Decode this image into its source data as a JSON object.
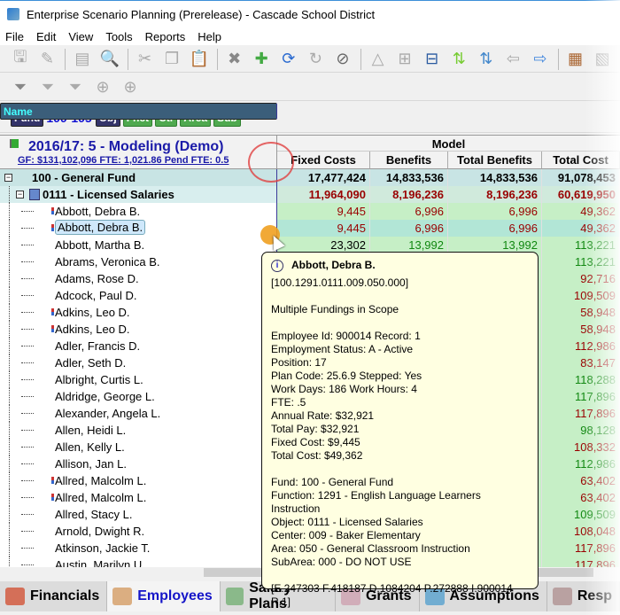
{
  "window": {
    "title": "Enterprise Scenario Planning (Prerelease) - Cascade School District"
  },
  "menu": [
    "File",
    "Edit",
    "View",
    "Tools",
    "Reports",
    "Help"
  ],
  "toolbar1": [
    "save-icon",
    "edit-icon",
    "print-preview-icon",
    "search-report-icon",
    "cut-icon",
    "copy-icon",
    "paste-icon",
    "delete-icon",
    "add-icon",
    "refresh-icon",
    "reload-icon",
    "cancel-icon",
    "budget-icon",
    "expand-icon",
    "collapse-icon",
    "sort-up-icon",
    "sort-down-icon",
    "back-icon",
    "forward-icon",
    "calculator-icon",
    "excel-icon"
  ],
  "toolbar2": [
    "new-filter-icon",
    "edit-filter-icon",
    "remove-filter-icon",
    "target-icon",
    "target-clear-icon"
  ],
  "filters": {
    "chips": [
      {
        "label": "Fund",
        "style": "navy"
      },
      {
        "label": "100-105",
        "style": "range"
      },
      {
        "label": "Obj",
        "style": "navy"
      },
      {
        "label": "Fnct",
        "style": "grn"
      },
      {
        "label": "Ctr",
        "style": "grn"
      },
      {
        "label": "Area",
        "style": "grn"
      },
      {
        "label": "Sub",
        "style": "grn"
      },
      {
        "label": "Name",
        "style": "nm"
      }
    ]
  },
  "grid": {
    "scenario_title": "2016/17: 5 - Modeling  (Demo)",
    "scenario_summary": "GF: $131,102,096  FTE: 1,021.86  Pend FTE: 0.5",
    "group_header": "Model",
    "columns": [
      "Fixed Costs",
      "Benefits",
      "Total Benefits",
      "Total Cost"
    ],
    "colors": {
      "red": "#990000",
      "green": "#118811",
      "black": "#000000"
    },
    "rows": [
      {
        "level": 0,
        "name": "100 - General Fund",
        "values": [
          "17,477,424",
          "14,833,536",
          "14,833,536",
          "91,078,453"
        ],
        "color": "black"
      },
      {
        "level": 1,
        "name": "0111 - Licensed Salaries",
        "values": [
          "11,964,090",
          "8,196,236",
          "8,196,236",
          "60,619,950"
        ],
        "color": "red"
      },
      {
        "level": 2,
        "name": "Abbott, Debra B.",
        "multi": true,
        "values": [
          "9,445",
          "6,996",
          "6,996",
          "49,362"
        ],
        "color": "red"
      },
      {
        "level": 2,
        "name": "Abbott, Debra B.",
        "multi": true,
        "selected": true,
        "values": [
          "9,445",
          "6,996",
          "6,996",
          "49,362"
        ],
        "color": "red"
      },
      {
        "level": 2,
        "name": "Abbott, Martha B.",
        "values": [
          "23,302",
          "13,992",
          "13,992",
          "113,221"
        ],
        "color": "green",
        "fixedColor": "black"
      },
      {
        "level": 2,
        "name": "Abrams, Veronica B.",
        "values": [
          "",
          "",
          "",
          "113,221"
        ],
        "color": "green"
      },
      {
        "level": 2,
        "name": "Adams, Rose D.",
        "values": [
          "",
          "",
          "",
          "92,716"
        ],
        "color": "red"
      },
      {
        "level": 2,
        "name": "Adcock, Paul D.",
        "values": [
          "",
          "",
          "",
          "109,509"
        ],
        "color": "red"
      },
      {
        "level": 2,
        "name": "Adkins, Leo D.",
        "multi": true,
        "values": [
          "",
          "",
          "",
          "58,948"
        ],
        "color": "red"
      },
      {
        "level": 2,
        "name": "Adkins, Leo D.",
        "multi": true,
        "values": [
          "",
          "",
          "",
          "58,948"
        ],
        "color": "red"
      },
      {
        "level": 2,
        "name": "Adler, Francis D.",
        "values": [
          "",
          "",
          "",
          "112,986"
        ],
        "color": "red"
      },
      {
        "level": 2,
        "name": "Adler, Seth D.",
        "values": [
          "",
          "",
          "",
          "83,147"
        ],
        "color": "red"
      },
      {
        "level": 2,
        "name": "Albright, Curtis L.",
        "values": [
          "",
          "",
          "",
          "118,288"
        ],
        "color": "green"
      },
      {
        "level": 2,
        "name": "Aldridge, George L.",
        "values": [
          "",
          "",
          "",
          "117,896"
        ],
        "color": "green"
      },
      {
        "level": 2,
        "name": "Alexander, Angela L.",
        "values": [
          "",
          "",
          "",
          "117,896"
        ],
        "color": "red"
      },
      {
        "level": 2,
        "name": "Allen, Heidi L.",
        "values": [
          "",
          "",
          "",
          "98,128"
        ],
        "color": "green"
      },
      {
        "level": 2,
        "name": "Allen, Kelly L.",
        "values": [
          "",
          "",
          "",
          "108,332"
        ],
        "color": "red"
      },
      {
        "level": 2,
        "name": "Allison, Jan L.",
        "values": [
          "",
          "",
          "",
          "112,986"
        ],
        "color": "green"
      },
      {
        "level": 2,
        "name": "Allred, Malcolm L.",
        "multi": true,
        "values": [
          "",
          "",
          "",
          "63,402"
        ],
        "color": "red"
      },
      {
        "level": 2,
        "name": "Allred, Malcolm L.",
        "multi": true,
        "values": [
          "",
          "",
          "",
          "63,402"
        ],
        "color": "red"
      },
      {
        "level": 2,
        "name": "Allred, Stacy L.",
        "values": [
          "",
          "",
          "",
          "109,509"
        ],
        "color": "green"
      },
      {
        "level": 2,
        "name": "Arnold, Dwight R.",
        "values": [
          "",
          "",
          "",
          "108,048"
        ],
        "color": "red"
      },
      {
        "level": 2,
        "name": "Atkinson, Jackie T.",
        "values": [
          "",
          "",
          "",
          "117,896"
        ],
        "color": "red"
      },
      {
        "level": 2,
        "name": "Austin, Marilyn U.",
        "values": [
          "",
          "",
          "",
          "117,896"
        ],
        "color": "red"
      }
    ]
  },
  "tooltip": {
    "title": "Abbott, Debra B.",
    "blocks": [
      [
        "[100.1291.0111.009.050.000]"
      ],
      [
        "Multiple Fundings in Scope"
      ],
      [
        "Employee Id: 900014   Record: 1",
        "Employment Status: A - Active",
        "Position: 17",
        "Plan Code: 25.6.9  Stepped: Yes",
        "Work Days: 186  Work Hours: 4",
        "FTE: .5",
        "Annual Rate: $32,921",
        "Total Pay: $32,921",
        "Fixed Cost: $9,445",
        "Total Cost: $49,362"
      ],
      [
        "Fund: 100 - General Fund",
        "Function: 1291 - English Language Learners Instruction",
        "Object: 0111 - Licensed Salaries",
        "Center: 009 - Baker Elementary",
        "Area: 050 - General Classroom Instruction",
        "SubArea: 000 - DO NOT USE"
      ],
      [
        "[E.247303 F.418187 D.1084204 P.272888 I.900014 R.1]"
      ]
    ]
  },
  "tabs": [
    {
      "label": "Financials",
      "icon": "financials-icon",
      "color": "#d04020"
    },
    {
      "label": "Employees",
      "icon": "employees-icon",
      "active": true,
      "color": "#d09050"
    },
    {
      "label": "Salary Plans",
      "icon": "salary-plans-icon",
      "color": "#6a6"
    },
    {
      "label": "Grants",
      "icon": "grants-icon",
      "color": "#c9a"
    },
    {
      "label": "Assumptions",
      "icon": "assumptions-icon",
      "color": "#49c"
    },
    {
      "label": "Resp",
      "icon": "building-icon",
      "color": "#a88"
    }
  ]
}
